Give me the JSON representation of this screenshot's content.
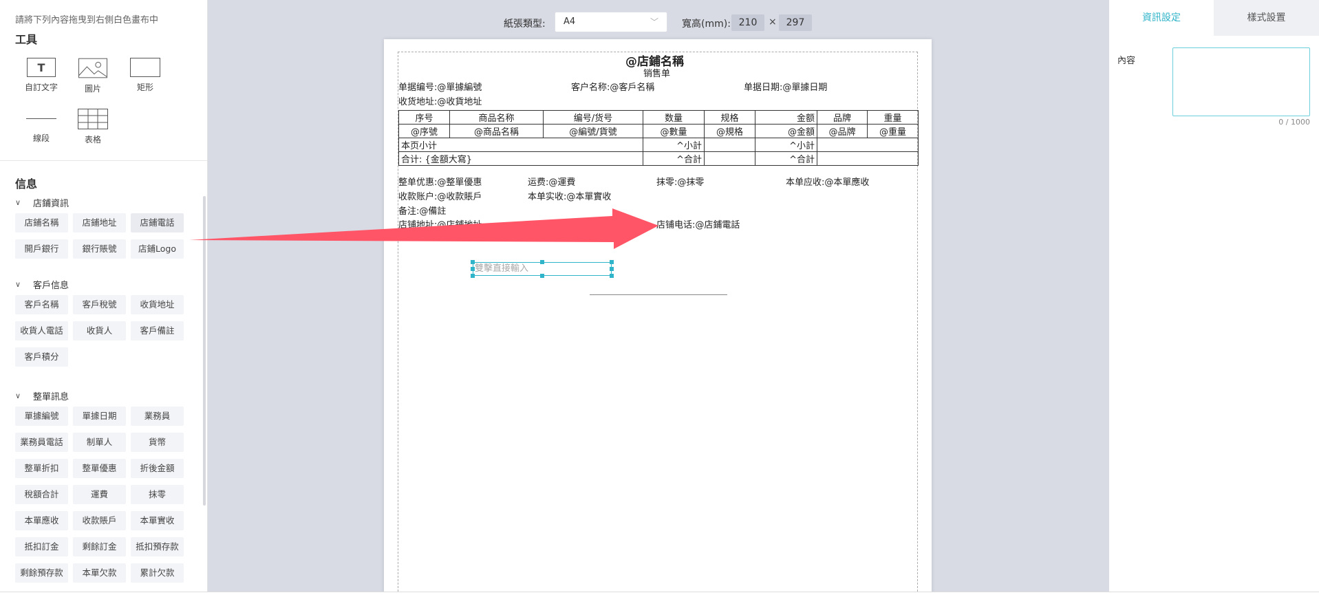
{
  "left": {
    "hint": "請將下列內容拖曳到右側白色畫布中",
    "tools_title": "工具",
    "tools": [
      {
        "label": "自訂文字",
        "icon": "text-icon",
        "glyph": "T"
      },
      {
        "label": "圖片",
        "icon": "image-icon"
      },
      {
        "label": "矩形",
        "icon": "rectangle-icon"
      },
      {
        "label": "線段",
        "icon": "line-icon"
      },
      {
        "label": "表格",
        "icon": "table-icon"
      }
    ],
    "info_title": "信息",
    "categories": [
      {
        "label": "店鋪資訊",
        "chips": [
          "店鋪名稱",
          "店鋪地址",
          "店鋪電話",
          "開戶銀行",
          "銀行賬號",
          "店鋪Logo"
        ]
      },
      {
        "label": "客戶信息",
        "chips": [
          "客戶名稱",
          "客戶稅號",
          "收貨地址",
          "收貨人電話",
          "收貨人",
          "客戶備註",
          "客戶積分"
        ]
      },
      {
        "label": "整單訊息",
        "chips": [
          "單據編號",
          "單據日期",
          "業務員",
          "業務員電話",
          "制單人",
          "貨幣",
          "整單折扣",
          "整單優惠",
          "折後金額",
          "稅額合計",
          "運費",
          "抹零",
          "本單應收",
          "收款賬戶",
          "本單實收",
          "抵扣訂金",
          "剩餘訂金",
          "抵扣預存款",
          "剩餘預存款",
          "本單欠款",
          "累計欠款"
        ]
      }
    ]
  },
  "toolbar": {
    "paper_label": "紙張類型:",
    "paper_value": "A4",
    "size_label": "寬高(mm):",
    "width": "210",
    "times": "×",
    "height": "297"
  },
  "paper": {
    "title": "@店鋪名稱",
    "subtitle": "销售单",
    "row1": [
      "单据编号:@單據編號",
      "客户名称:@客戶名稱",
      "单据日期:@單據日期"
    ],
    "address": "收货地址:@收貨地址",
    "table": {
      "headers": [
        "序号",
        "商品名称",
        "编号/货号",
        "数量",
        "规格",
        "金额",
        "品牌",
        "重量"
      ],
      "row": [
        "@序號",
        "@商品名稱",
        "@編號/貨號",
        "@數量",
        "@規格",
        "@金額",
        "@品牌",
        "@重量"
      ],
      "subtotal_label": "本页小计",
      "subtotal_qty": "^小計",
      "subtotal_amt": "^小計",
      "total_label": "合计: {金額大寫}",
      "total_qty": "^合計",
      "total_amt": "^合計"
    },
    "summary1": [
      "整单优惠:@整單優惠",
      "运费:@運費",
      "抹零:@抹零",
      "本单应收:@本單應收"
    ],
    "summary2": [
      "收款账户:@收款賬戶",
      "本单实收:@本單實收"
    ],
    "remark": "备注:@備註",
    "shop_address": "店铺地址:@店鋪地址",
    "shop_phone": "店铺电话:@店鋪電話",
    "text_placeholder": "雙擊直接輸入"
  },
  "right": {
    "tab_info": "資訊設定",
    "tab_style": "樣式設置",
    "content_label": "內容",
    "counter": "0 / 1000"
  },
  "colors": {
    "accent": "#2fb4c9",
    "arrow": "#ff5566"
  }
}
